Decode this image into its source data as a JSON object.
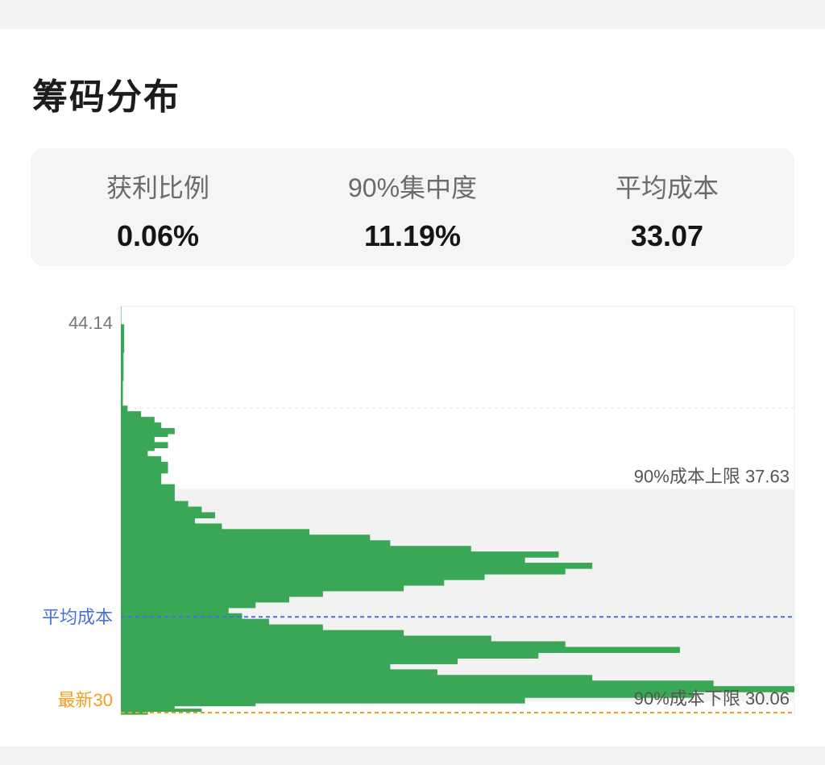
{
  "page": {
    "title": "筹码分布"
  },
  "stats": [
    {
      "label": "获利比例",
      "value": "0.06%"
    },
    {
      "label": "90%集中度",
      "value": "11.19%"
    },
    {
      "label": "平均成本",
      "value": "33.07"
    }
  ],
  "chart_data": {
    "type": "bar",
    "orientation": "horizontal",
    "title": "",
    "xlabel": "",
    "ylabel": "",
    "ylim": [
      29.6,
      44.14
    ],
    "y_top_label": "44.14",
    "bar_color": "#3aa757",
    "avg_cost": {
      "label": "平均成本",
      "value": 33.07,
      "color": "#4a6ee0"
    },
    "latest": {
      "label": "最新30",
      "value": 29.6,
      "color": "#f0a020"
    },
    "range_90": {
      "upper_label": "90%成本上限 37.63",
      "upper": 37.63,
      "lower_label": "90%成本下限 30.06",
      "lower": 30.06
    },
    "note": "values are relative chip volume, 0-100 of chart width",
    "profile": [
      [
        44.14,
        0
      ],
      [
        43.5,
        0.5
      ],
      [
        42.5,
        0.4
      ],
      [
        41.5,
        0.3
      ],
      [
        40.6,
        1
      ],
      [
        40.4,
        3
      ],
      [
        40.2,
        5
      ],
      [
        40.0,
        6
      ],
      [
        39.8,
        8
      ],
      [
        39.6,
        7
      ],
      [
        39.5,
        5
      ],
      [
        39.3,
        7
      ],
      [
        39.1,
        5
      ],
      [
        39.0,
        4
      ],
      [
        38.8,
        6
      ],
      [
        38.6,
        7
      ],
      [
        38.4,
        7
      ],
      [
        38.2,
        6
      ],
      [
        38.0,
        6
      ],
      [
        37.8,
        8
      ],
      [
        37.5,
        8
      ],
      [
        37.2,
        10
      ],
      [
        37.0,
        12
      ],
      [
        36.8,
        14
      ],
      [
        36.6,
        11
      ],
      [
        36.4,
        15
      ],
      [
        36.2,
        28
      ],
      [
        36.0,
        37
      ],
      [
        35.8,
        40
      ],
      [
        35.6,
        52
      ],
      [
        35.4,
        65
      ],
      [
        35.2,
        60
      ],
      [
        35.0,
        70
      ],
      [
        34.8,
        66
      ],
      [
        34.6,
        54
      ],
      [
        34.4,
        48
      ],
      [
        34.2,
        42
      ],
      [
        34.0,
        30
      ],
      [
        33.8,
        25
      ],
      [
        33.6,
        20
      ],
      [
        33.4,
        16
      ],
      [
        33.2,
        18
      ],
      [
        33.0,
        22
      ],
      [
        32.8,
        30
      ],
      [
        32.6,
        42
      ],
      [
        32.4,
        55
      ],
      [
        32.2,
        66
      ],
      [
        32.0,
        83
      ],
      [
        31.8,
        62
      ],
      [
        31.6,
        50
      ],
      [
        31.4,
        40
      ],
      [
        31.2,
        47
      ],
      [
        31.0,
        70
      ],
      [
        30.8,
        88
      ],
      [
        30.6,
        100
      ],
      [
        30.4,
        85
      ],
      [
        30.2,
        60
      ],
      [
        30.0,
        20
      ],
      [
        29.9,
        8
      ],
      [
        29.8,
        12
      ],
      [
        29.7,
        4
      ],
      [
        29.6,
        2
      ]
    ]
  }
}
